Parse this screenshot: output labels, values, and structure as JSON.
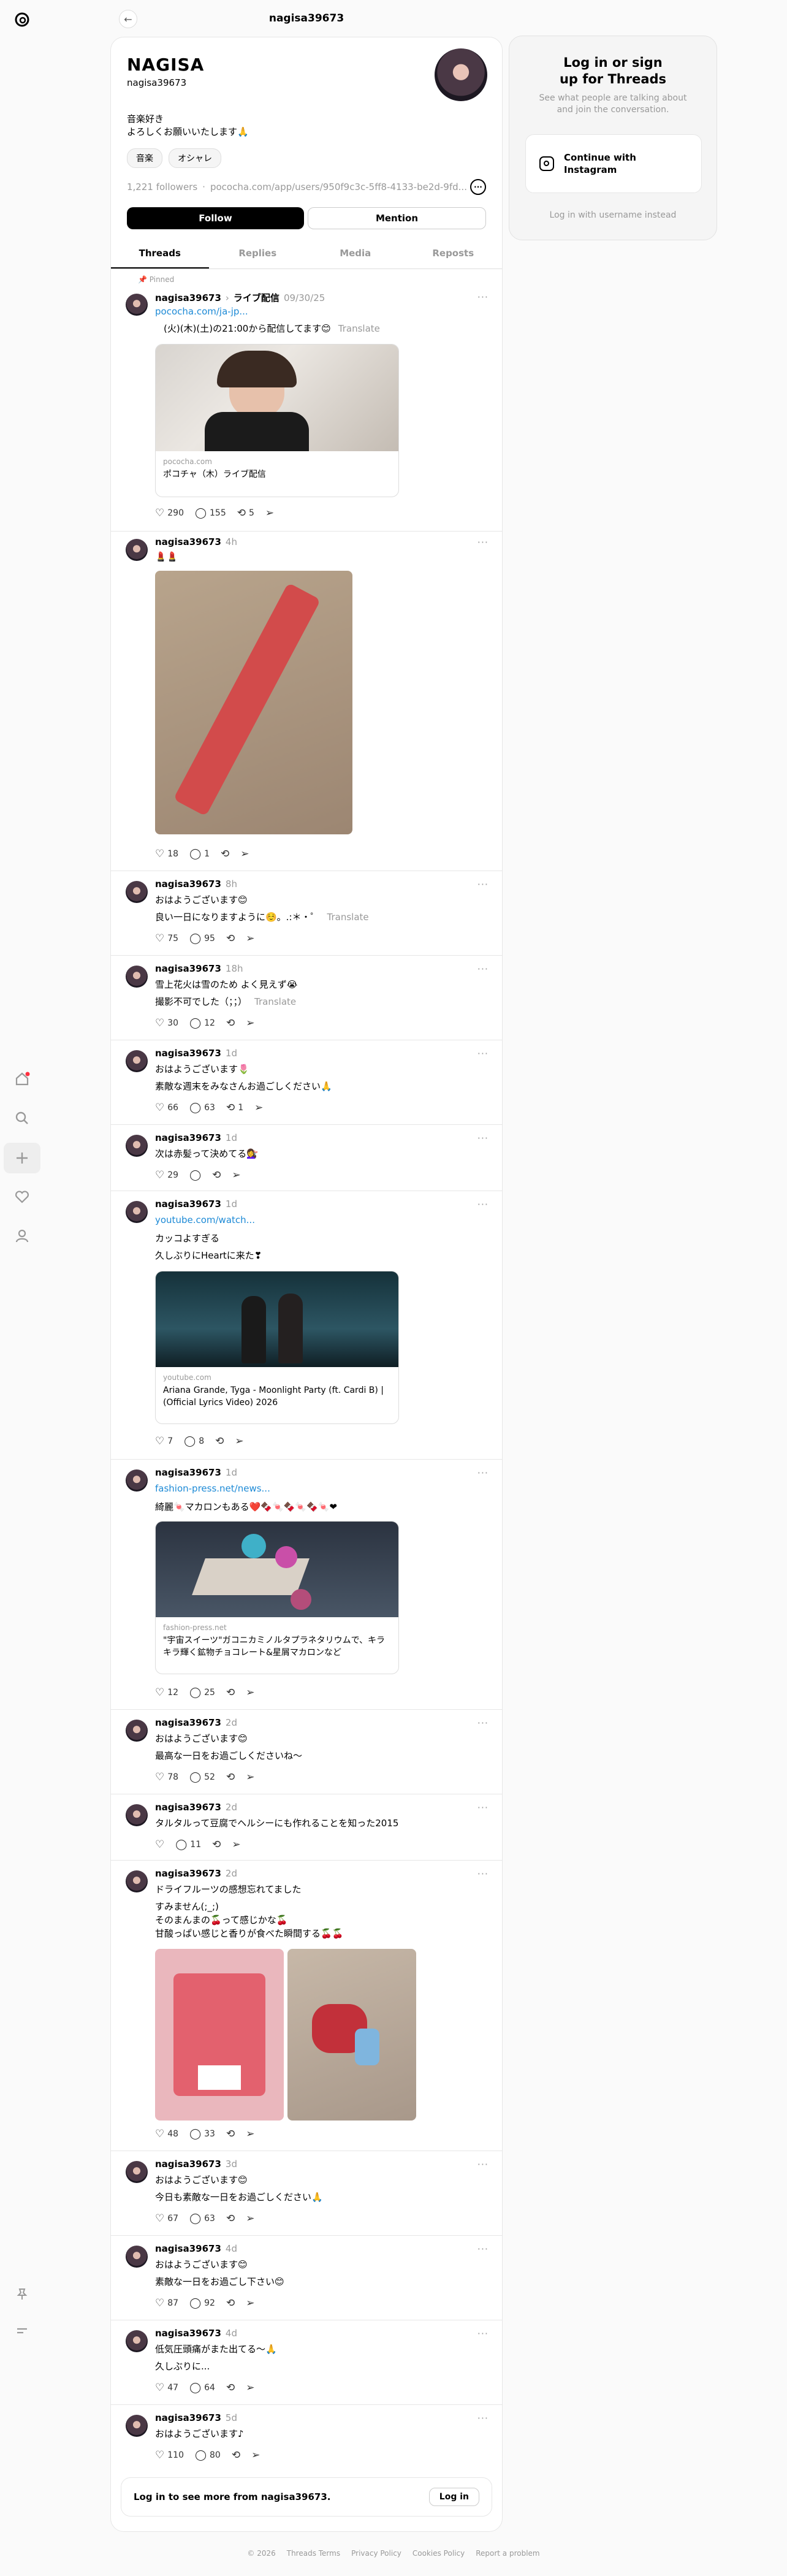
{
  "header": {
    "title": "nagisa39673"
  },
  "profile": {
    "name": "NAGISA",
    "handle": "nagisa39673",
    "bio_line1": "音楽好き",
    "bio_line2": "よろしくお願いいたします🙏",
    "chips": [
      "音楽",
      "オシャレ"
    ],
    "followers": "1,221 followers",
    "link": "pococha.com/app/users/950f9c3c-5ff8-4133-be2d-9fd...",
    "follow_label": "Follow",
    "mention_label": "Mention"
  },
  "tabs": [
    "Threads",
    "Replies",
    "Media",
    "Reposts"
  ],
  "pinned_label": "Pinned",
  "posts": [
    {
      "user": "nagisa39673",
      "tag": "ライブ配信",
      "time": "09/30/25",
      "link": "pococha.com/ja-jp...",
      "text1": "(火)(木)(土)の21:00から配信してます😊",
      "translate": "Translate",
      "card_domain": "pococha.com",
      "card_title": "ポコチャ（木）ライブ配信",
      "likes": "290",
      "replies": "155",
      "reposts": "",
      "shares": "5"
    },
    {
      "user": "nagisa39673",
      "time": "4h",
      "text1": "💄💄",
      "likes": "18",
      "replies": "1"
    },
    {
      "user": "nagisa39673",
      "time": "8h",
      "text1": "おはようございます😊",
      "text2": "良い一日になりますように☺️。.:＊・゜",
      "translate": "Translate",
      "likes": "75",
      "replies": "95"
    },
    {
      "user": "nagisa39673",
      "time": "18h",
      "text1": "雪上花火は雪のため よく見えず😭",
      "text2": "撮影不可でした（；；）",
      "translate": "Translate",
      "likes": "30",
      "replies": "12"
    },
    {
      "user": "nagisa39673",
      "time": "1d",
      "text1": "おはようございます🌷",
      "text2": "素敵な週末をみなさんお過ごしください🙏",
      "likes": "66",
      "replies": "63",
      "reposts": "1"
    },
    {
      "user": "nagisa39673",
      "time": "1d",
      "text1": "次は赤髪って決めてる💇‍♀️",
      "likes": "29"
    },
    {
      "user": "nagisa39673",
      "time": "1d",
      "link": "youtube.com/watch...",
      "text1": "カッコよすぎる",
      "text2": "久しぶりにHeartに来た❣",
      "card_domain": "youtube.com",
      "card_title": "Ariana Grande, Tyga - Moonlight Party (ft. Cardi B) | (Official Lyrics Video) 2026",
      "likes": "7",
      "replies": "8"
    },
    {
      "user": "nagisa39673",
      "time": "1d",
      "link": "fashion-press.net/news...",
      "text1": "綺麗🍬マカロンもある❤️🍫🍬🍫🍬🍫🍬❤",
      "card_domain": "fashion-press.net",
      "card_title": "\"宇宙スイーツ\"ガコニカミノルタプラネタリウムで、キラキラ輝く鉱物チョコレート&星屑マカロンなど",
      "likes": "12",
      "replies": "25"
    },
    {
      "user": "nagisa39673",
      "time": "2d",
      "text1": "おはようございます😊",
      "text2": "最高な一日をお過ごしくださいね〜",
      "likes": "78",
      "replies": "52"
    },
    {
      "user": "nagisa39673",
      "time": "2d",
      "text1": "タルタルって豆腐でヘルシーにも作れることを知った2015",
      "likes": "",
      "replies": "11"
    },
    {
      "user": "nagisa39673",
      "time": "2d",
      "text1": "ドライフルーツの感想忘れてました",
      "text2": "すみません(;_;)",
      "text3": "そのまんまの🍒って感じかな🍒",
      "text4": "甘酸っぱい感じと香りが食べた瞬間する🍒🍒",
      "likes": "48",
      "replies": "33"
    },
    {
      "user": "nagisa39673",
      "time": "3d",
      "text1": "おはようございます😊",
      "text2": "今日も素敵な一日をお過ごしください🙏",
      "likes": "67",
      "replies": "63"
    },
    {
      "user": "nagisa39673",
      "time": "4d",
      "text1": "おはようございます😊",
      "text2": "素敵な一日をお過ごし下さい😊",
      "likes": "87",
      "replies": "92"
    },
    {
      "user": "nagisa39673",
      "time": "4d",
      "text1": "低気圧頭痛がまた出てる〜🙏",
      "text2": "久しぶりに...",
      "likes": "47",
      "replies": "64"
    },
    {
      "user": "nagisa39673",
      "time": "5d",
      "text1": "おはようございます♪",
      "likes": "110",
      "replies": "80"
    }
  ],
  "login_card": {
    "title": "Log in or sign up for Threads",
    "subtitle": "See what people are talking about and join the conversation.",
    "instagram_button": "Continue with Instagram",
    "username_link": "Log in with username instead"
  },
  "see_more": {
    "text": "Log in to see more from nagisa39673.",
    "button": "Log in"
  },
  "footer": [
    "© 2026",
    "Threads Terms",
    "Privacy Policy",
    "Cookies Policy",
    "Report a problem"
  ],
  "colors": {
    "link": "#1d8ad6",
    "muted": "#999999",
    "notification_dot": "#ff3040"
  },
  "icons": {
    "logo": "threads-logo-icon",
    "home": "home-icon",
    "search": "search-icon",
    "create": "plus-icon",
    "activity": "heart-icon",
    "profile": "person-icon",
    "pin": "pin-icon",
    "menu": "hamburger-icon"
  }
}
